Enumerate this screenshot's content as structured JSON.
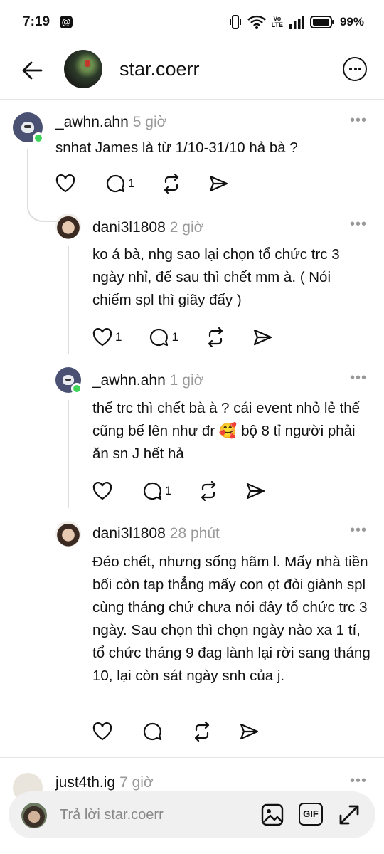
{
  "status_bar": {
    "time": "7:19",
    "app_glyph": "@",
    "volte_top": "Vo",
    "volte_bottom": "LTE",
    "battery": "99%"
  },
  "header": {
    "title": "star.coerr"
  },
  "comments": [
    {
      "username": "_awhn.ahn",
      "time": "5 giờ",
      "text": "snhat James là từ 1/10-31/10 hả bà ?",
      "likes": "",
      "replies": "1"
    },
    {
      "username": "dani3l1808",
      "time": "2 giờ",
      "text": "ko á bà, nhg sao lại chọn tổ chức trc 3 ngày nhỉ, để sau thì chết mm à. ( Nói chiếm spl thì giãy đấy )",
      "likes": "1",
      "replies": "1"
    },
    {
      "username": "_awhn.ahn",
      "time": "1 giờ",
      "text": "thế trc thì chết bà  à ? cái event nhỏ lẻ thế cũng bế lên như đr 🥰 bộ 8 tỉ người phải ăn sn J hết hả",
      "likes": "",
      "replies": "1"
    },
    {
      "username": "dani3l1808",
      "time": "28 phút",
      "text": "Đéo chết, nhưng sống hãm l. Mấy nhà tiền bối còn tap thẳng mấy con ọt đòi giành spl cùng tháng chứ chưa nói đây tổ chức trc 3 ngày. Sau chọn thì chọn ngày nào xa 1 tí, tổ chức tháng 9 đag lành lại rời sang tháng 10, lại còn sát ngày snh của j.",
      "likes": "",
      "replies": ""
    },
    {
      "username": "just4th.ig",
      "time": "7 giờ"
    }
  ],
  "reply_bar": {
    "placeholder": "Trả lời star.coerr",
    "gif_label": "GIF"
  },
  "icons": [
    "back-arrow-icon",
    "more-icon",
    "heart-icon",
    "comment-icon",
    "repost-icon",
    "share-icon",
    "image-icon",
    "expand-icon"
  ]
}
